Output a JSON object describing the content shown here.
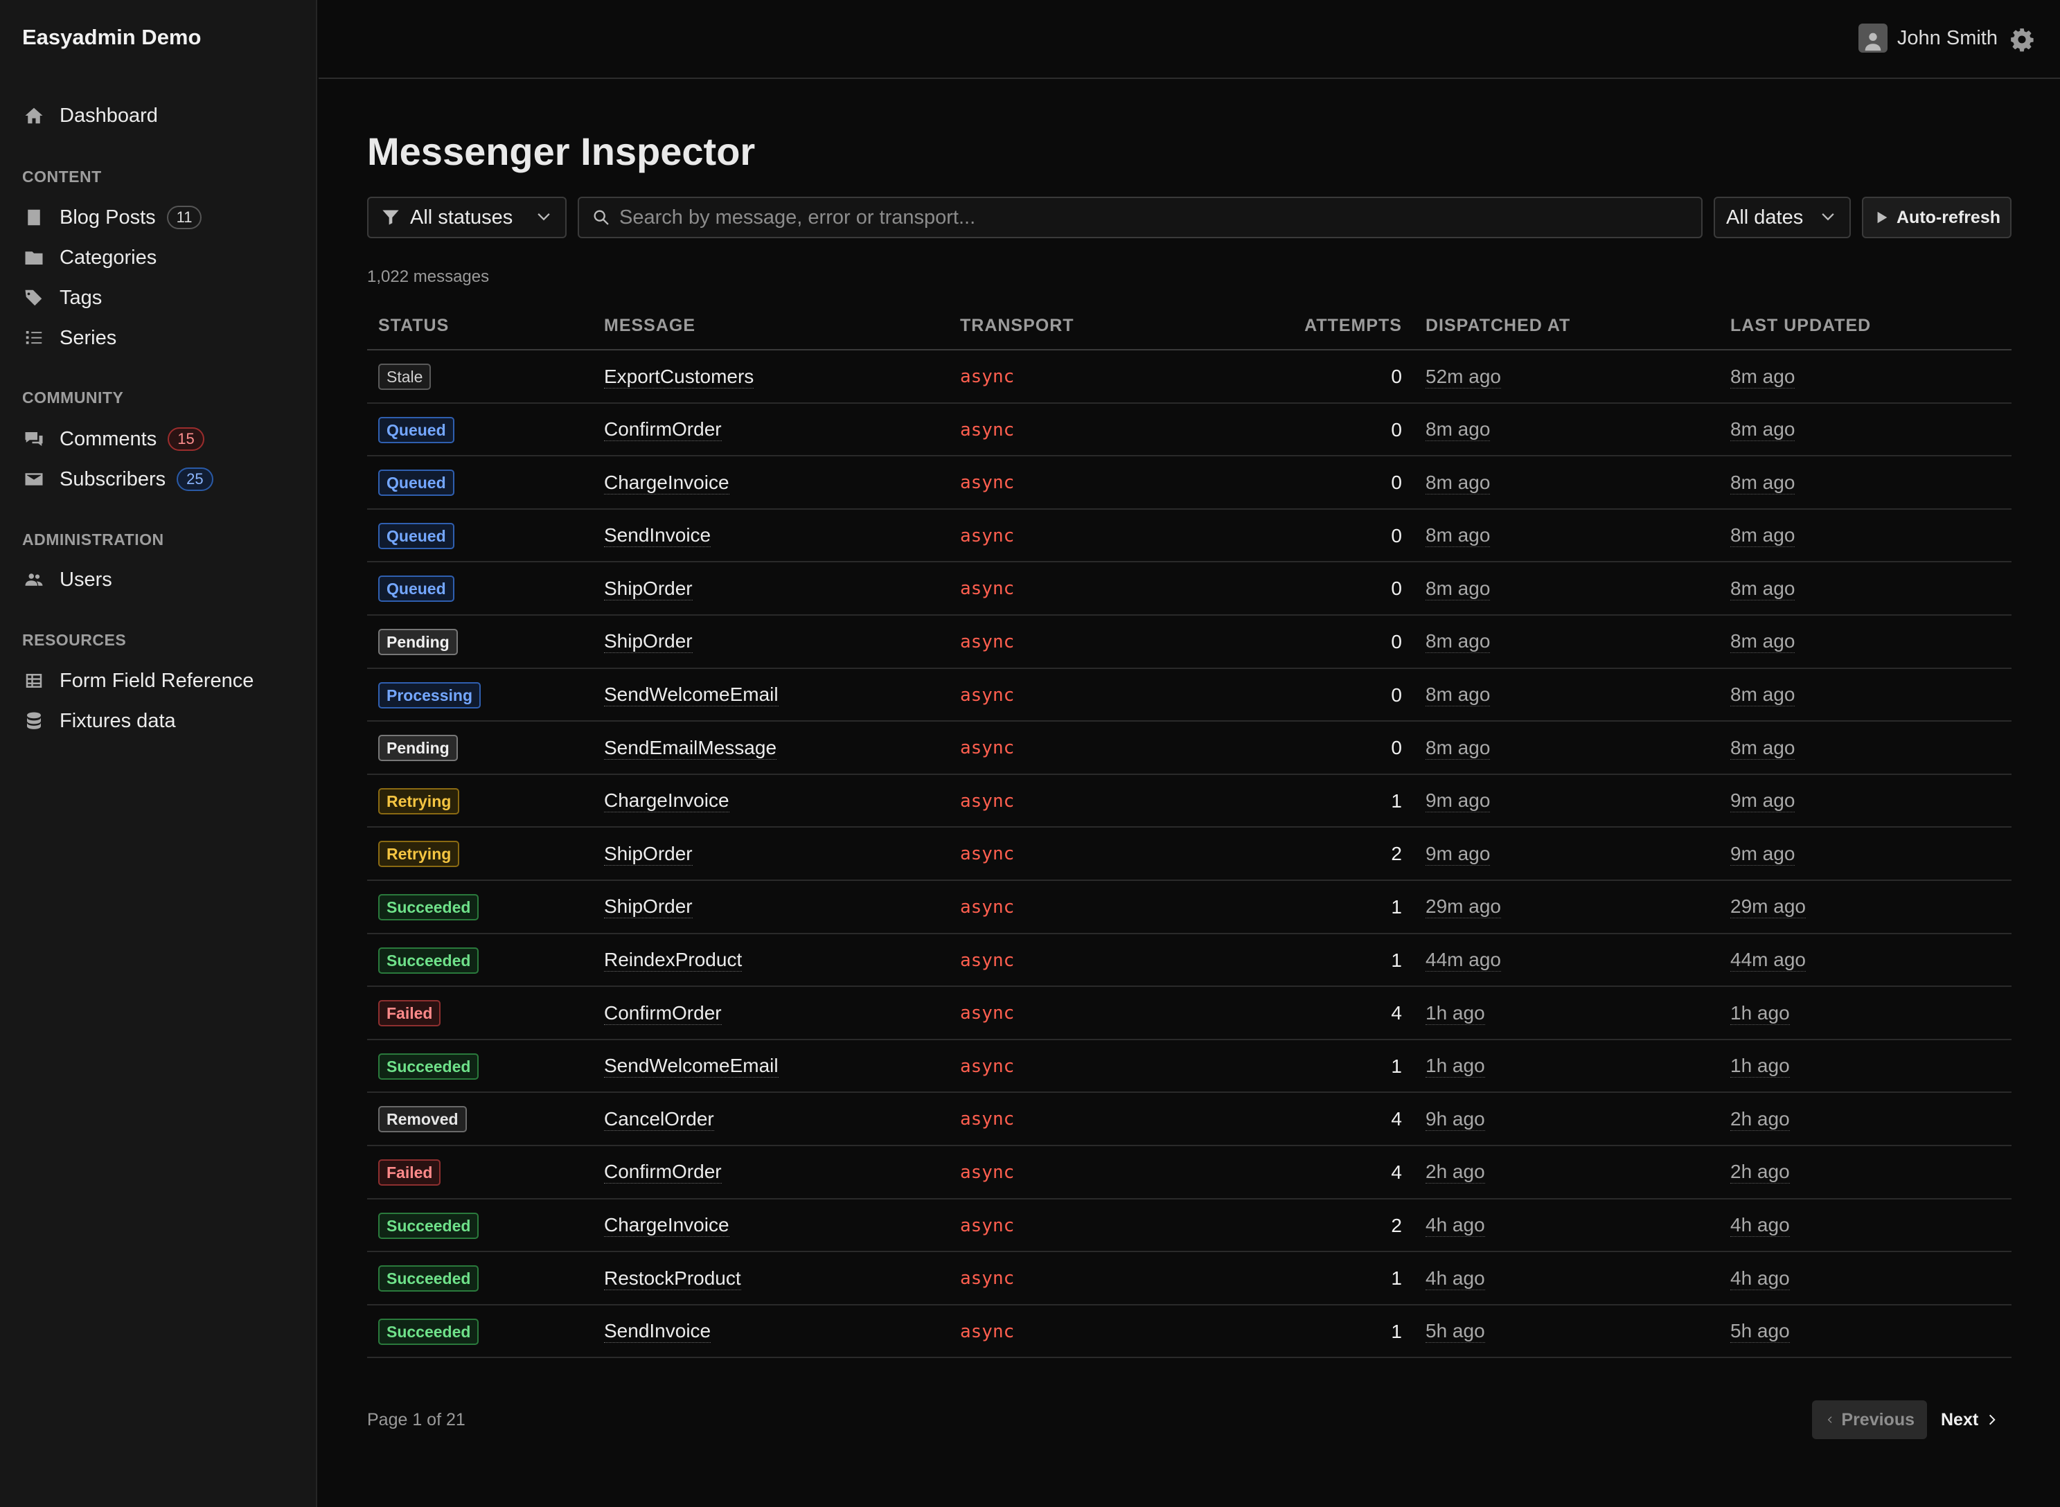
{
  "app": {
    "brand": "Easyadmin Demo"
  },
  "sidebar": {
    "dashboard": {
      "label": "Dashboard",
      "icon": "home-icon"
    },
    "sections": [
      {
        "title": "CONTENT",
        "items": [
          {
            "label": "Blog Posts",
            "icon": "document-icon",
            "count": "11"
          },
          {
            "label": "Categories",
            "icon": "folder-icon"
          },
          {
            "label": "Tags",
            "icon": "tags-icon"
          },
          {
            "label": "Series",
            "icon": "list-icon"
          }
        ]
      },
      {
        "title": "COMMUNITY",
        "items": [
          {
            "label": "Comments",
            "icon": "comments-icon",
            "count": "15"
          },
          {
            "label": "Subscribers",
            "icon": "envelope-icon",
            "count": "25"
          }
        ]
      },
      {
        "title": "ADMINISTRATION",
        "items": [
          {
            "label": "Users",
            "icon": "users-icon"
          }
        ]
      },
      {
        "title": "RESOURCES",
        "items": [
          {
            "label": "Form Field Reference",
            "icon": "table-icon"
          },
          {
            "label": "Fixtures data",
            "icon": "database-icon"
          }
        ]
      }
    ]
  },
  "header": {
    "user_name": "John Smith"
  },
  "page": {
    "title": "Messenger Inspector",
    "filters": {
      "status_label": "All statuses",
      "search_placeholder": "Search by message, error or transport...",
      "dates_label": "All dates",
      "auto_refresh_label": "Auto-refresh"
    },
    "message_count": "1,022 messages",
    "columns": {
      "status": "STATUS",
      "message": "MESSAGE",
      "transport": "TRANSPORT",
      "attempts": "ATTEMPTS",
      "dispatched": "DISPATCHED AT",
      "updated": "LAST UPDATED"
    },
    "rows": [
      {
        "status": "Stale",
        "kind": "stale",
        "message": "ExportCustomers",
        "transport": "async",
        "attempts": "0",
        "dispatched": "52m ago",
        "updated": "8m ago"
      },
      {
        "status": "Queued",
        "kind": "queued",
        "message": "ConfirmOrder",
        "transport": "async",
        "attempts": "0",
        "dispatched": "8m ago",
        "updated": "8m ago"
      },
      {
        "status": "Queued",
        "kind": "queued",
        "message": "ChargeInvoice",
        "transport": "async",
        "attempts": "0",
        "dispatched": "8m ago",
        "updated": "8m ago"
      },
      {
        "status": "Queued",
        "kind": "queued",
        "message": "SendInvoice",
        "transport": "async",
        "attempts": "0",
        "dispatched": "8m ago",
        "updated": "8m ago"
      },
      {
        "status": "Queued",
        "kind": "queued",
        "message": "ShipOrder",
        "transport": "async",
        "attempts": "0",
        "dispatched": "8m ago",
        "updated": "8m ago"
      },
      {
        "status": "Pending",
        "kind": "pending",
        "message": "ShipOrder",
        "transport": "async",
        "attempts": "0",
        "dispatched": "8m ago",
        "updated": "8m ago"
      },
      {
        "status": "Processing",
        "kind": "processing",
        "message": "SendWelcomeEmail",
        "transport": "async",
        "attempts": "0",
        "dispatched": "8m ago",
        "updated": "8m ago"
      },
      {
        "status": "Pending",
        "kind": "pending",
        "message": "SendEmailMessage",
        "transport": "async",
        "attempts": "0",
        "dispatched": "8m ago",
        "updated": "8m ago"
      },
      {
        "status": "Retrying",
        "kind": "retrying",
        "message": "ChargeInvoice",
        "transport": "async",
        "attempts": "1",
        "dispatched": "9m ago",
        "updated": "9m ago"
      },
      {
        "status": "Retrying",
        "kind": "retrying",
        "message": "ShipOrder",
        "transport": "async",
        "attempts": "2",
        "dispatched": "9m ago",
        "updated": "9m ago"
      },
      {
        "status": "Succeeded",
        "kind": "succeeded",
        "message": "ShipOrder",
        "transport": "async",
        "attempts": "1",
        "dispatched": "29m ago",
        "updated": "29m ago"
      },
      {
        "status": "Succeeded",
        "kind": "succeeded",
        "message": "ReindexProduct",
        "transport": "async",
        "attempts": "1",
        "dispatched": "44m ago",
        "updated": "44m ago"
      },
      {
        "status": "Failed",
        "kind": "failed",
        "message": "ConfirmOrder",
        "transport": "async",
        "attempts": "4",
        "dispatched": "1h ago",
        "updated": "1h ago"
      },
      {
        "status": "Succeeded",
        "kind": "succeeded",
        "message": "SendWelcomeEmail",
        "transport": "async",
        "attempts": "1",
        "dispatched": "1h ago",
        "updated": "1h ago"
      },
      {
        "status": "Removed",
        "kind": "removed",
        "message": "CancelOrder",
        "transport": "async",
        "attempts": "4",
        "dispatched": "9h ago",
        "updated": "2h ago"
      },
      {
        "status": "Failed",
        "kind": "failed",
        "message": "ConfirmOrder",
        "transport": "async",
        "attempts": "4",
        "dispatched": "2h ago",
        "updated": "2h ago"
      },
      {
        "status": "Succeeded",
        "kind": "succeeded",
        "message": "ChargeInvoice",
        "transport": "async",
        "attempts": "2",
        "dispatched": "4h ago",
        "updated": "4h ago"
      },
      {
        "status": "Succeeded",
        "kind": "succeeded",
        "message": "RestockProduct",
        "transport": "async",
        "attempts": "1",
        "dispatched": "4h ago",
        "updated": "4h ago"
      },
      {
        "status": "Succeeded",
        "kind": "succeeded",
        "message": "SendInvoice",
        "transport": "async",
        "attempts": "1",
        "dispatched": "5h ago",
        "updated": "5h ago"
      }
    ],
    "pagination": {
      "info": "Page 1 of 21",
      "previous": "Previous",
      "next": "Next"
    }
  },
  "colors": {
    "background": "#0b0b0b",
    "sidebar": "#171717",
    "transport": "#ff5f4f",
    "queued": "#74a7ff",
    "retrying": "#f5c542",
    "succeeded": "#6fe28a",
    "failed": "#ff8a8a"
  }
}
